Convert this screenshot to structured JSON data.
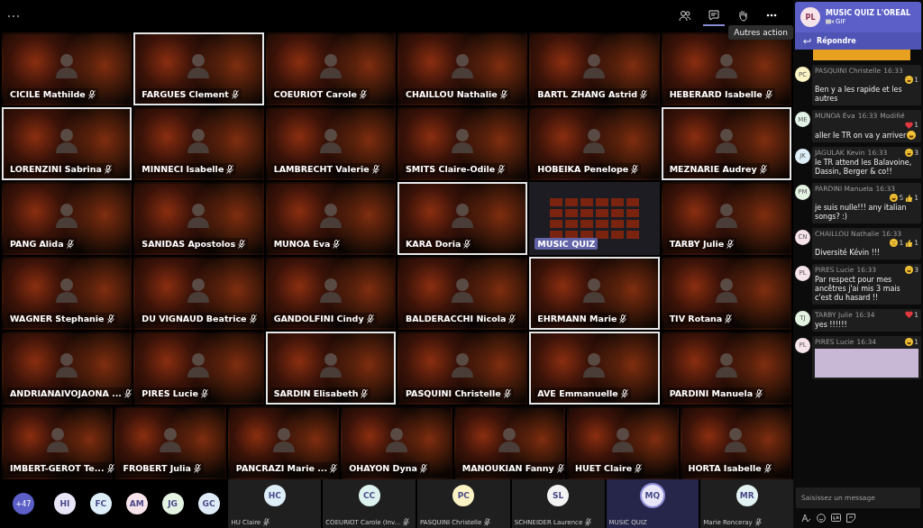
{
  "top_bar": {
    "actions": [
      {
        "kind": "participants",
        "selected": false
      },
      {
        "kind": "chat",
        "selected": true
      },
      {
        "kind": "hand",
        "selected": false
      },
      {
        "kind": "more",
        "selected": false
      }
    ],
    "tooltip": "Autres action"
  },
  "gallery": {
    "tiles": [
      {
        "name": "CICILE Mathilde",
        "framed": false,
        "kind": "camera",
        "muted": true
      },
      {
        "name": "FARGUES Clement",
        "framed": true,
        "kind": "camera",
        "muted": true
      },
      {
        "name": "COEURIOT Carole",
        "framed": false,
        "kind": "camera",
        "muted": true
      },
      {
        "name": "CHAILLOU Nathalie",
        "framed": false,
        "kind": "camera",
        "muted": true
      },
      {
        "name": "BARTL ZHANG Astrid",
        "framed": false,
        "kind": "camera",
        "muted": true
      },
      {
        "name": "HEBERARD Isabelle",
        "framed": false,
        "kind": "camera",
        "muted": true
      },
      {
        "name": "LORENZINI Sabrina",
        "framed": true,
        "kind": "camera",
        "muted": true
      },
      {
        "name": "MINNECI Isabelle",
        "framed": false,
        "kind": "camera",
        "muted": true
      },
      {
        "name": "LAMBRECHT Valerie",
        "framed": false,
        "kind": "camera",
        "muted": true
      },
      {
        "name": "SMITS Claire-Odile",
        "framed": false,
        "kind": "camera",
        "muted": true
      },
      {
        "name": "HOBEIKA Penelope",
        "framed": false,
        "kind": "camera",
        "muted": true
      },
      {
        "name": "MEZNARIE Audrey",
        "framed": true,
        "kind": "camera",
        "muted": true
      },
      {
        "name": "PANG Alida",
        "framed": false,
        "kind": "camera",
        "muted": true
      },
      {
        "name": "SANIDAS Apostolos",
        "framed": false,
        "kind": "camera",
        "muted": true
      },
      {
        "name": "MUNOA Eva",
        "framed": false,
        "kind": "camera",
        "muted": true
      },
      {
        "name": "KARA Doria",
        "framed": true,
        "kind": "camera",
        "muted": true
      },
      {
        "name": "MUSIC QUIZ",
        "framed": false,
        "kind": "screen_share",
        "muted": false
      },
      {
        "name": "TARBY Julie",
        "framed": false,
        "kind": "camera",
        "muted": true
      },
      {
        "name": "WAGNER Stephanie",
        "framed": false,
        "kind": "camera",
        "muted": true
      },
      {
        "name": "DU VIGNAUD Beatrice",
        "framed": false,
        "kind": "camera",
        "muted": true
      },
      {
        "name": "GANDOLFINI Cindy",
        "framed": false,
        "kind": "camera",
        "muted": true
      },
      {
        "name": "BALDERACCHI Nicola",
        "framed": false,
        "kind": "camera",
        "muted": true
      },
      {
        "name": "EHRMANN Marie",
        "framed": true,
        "kind": "camera",
        "muted": true
      },
      {
        "name": "TIV Rotana",
        "framed": false,
        "kind": "camera",
        "muted": true
      },
      {
        "name": "ANDRIANAIVOJAONA ...",
        "framed": false,
        "kind": "camera",
        "muted": true
      },
      {
        "name": "PIRES Lucie",
        "framed": false,
        "kind": "camera",
        "muted": true
      },
      {
        "name": "SARDIN Elisabeth",
        "framed": true,
        "kind": "camera",
        "muted": true
      },
      {
        "name": "PASQUINI Christelle",
        "framed": false,
        "kind": "camera",
        "muted": true
      },
      {
        "name": "AVE Emmanuelle",
        "framed": true,
        "kind": "camera",
        "muted": true
      },
      {
        "name": "PARDINI Manuela",
        "framed": false,
        "kind": "camera",
        "muted": true
      },
      {
        "name": "IMBERT-GEROT Te...",
        "framed": false,
        "kind": "camera",
        "muted": true
      },
      {
        "name": "FROBERT Julia",
        "framed": false,
        "kind": "camera",
        "muted": true
      },
      {
        "name": "PANCRAZI Marie ...",
        "framed": false,
        "kind": "camera",
        "muted": true
      },
      {
        "name": "OHAYON Dyna",
        "framed": false,
        "kind": "camera",
        "muted": true
      },
      {
        "name": "MANOUKIAN Fanny",
        "framed": false,
        "kind": "camera",
        "muted": true
      },
      {
        "name": "HUET Claire",
        "framed": false,
        "kind": "camera",
        "muted": true
      },
      {
        "name": "HORTA Isabelle",
        "framed": false,
        "kind": "camera",
        "muted": true
      }
    ]
  },
  "bottom_bar": {
    "overflow": "+47",
    "avatars": [
      {
        "initials": "HI",
        "color": "#e8e6f7"
      },
      {
        "initials": "FC",
        "color": "#ddeef8"
      },
      {
        "initials": "AM",
        "color": "#f7e3ea"
      },
      {
        "initials": "JG",
        "color": "#e3f2e1"
      },
      {
        "initials": "GC",
        "color": "#dfeaf7"
      }
    ],
    "participants": [
      {
        "initials": "HC",
        "name": "HU Claire",
        "color": "#ddeef8",
        "muted": true,
        "selected": false
      },
      {
        "initials": "CC",
        "name": "COEURIOT Carole (Inv...",
        "color": "#dcf2ef",
        "muted": true,
        "selected": false
      },
      {
        "initials": "PC",
        "name": "PASQUINI Christelle",
        "color": "#fbf3c4",
        "muted": true,
        "selected": false
      },
      {
        "initials": "SL",
        "name": "SCHNEIDER Laurence",
        "color": "#f3f3f3",
        "muted": true,
        "selected": false
      },
      {
        "initials": "MQ",
        "name": "MUSIC QUIZ",
        "color": "#e8e6f7",
        "muted": false,
        "selected": true
      },
      {
        "initials": "MR",
        "name": "Marie Ronceray",
        "color": "#e3f2f2",
        "muted": true,
        "selected": false
      }
    ]
  },
  "chat": {
    "notification": {
      "initials": "PL",
      "title": "MUSIC QUIZ L'OREAL",
      "subtitle": "GIF",
      "reply": "Répondre"
    },
    "messages": [
      {
        "initials": "PC",
        "color": "#fbf3c4",
        "author": "PASQUINI Christelle",
        "time": "16:33",
        "text": "Ben y a les rapide et les autres",
        "reactions": [
          {
            "kind": "laugh",
            "count": "1"
          }
        ]
      },
      {
        "initials": "ME",
        "color": "#e3f2e6",
        "author": "MUNOA Eva",
        "time": "16:33",
        "edited": "Modifié",
        "text": "aller le TR on va y arriver",
        "emoji_end": true,
        "reactions": [
          {
            "kind": "heart",
            "count": "1"
          }
        ]
      },
      {
        "initials": "JK",
        "color": "#ddeef8",
        "author": "JAGULAK Kevin",
        "time": "16:33",
        "text": "le TR attend les Balavoine, Dassin, Berger & co!!",
        "reactions": [
          {
            "kind": "laugh",
            "count": "3"
          }
        ]
      },
      {
        "initials": "PM",
        "color": "#e3f2e1",
        "author": "PARDINI Manuela",
        "time": "16:33",
        "text": "je suis nulle!!! any italian songs? :)",
        "reactions": [
          {
            "kind": "laugh",
            "count": "5"
          },
          {
            "kind": "thumb",
            "count": "1"
          }
        ]
      },
      {
        "initials": "CN",
        "color": "#f7e3ea",
        "author": "CHAILLOU Nathalie",
        "time": "16:33",
        "text": "Diversité Kévin !!!",
        "reactions": [
          {
            "kind": "sad",
            "count": "1"
          },
          {
            "kind": "thumb",
            "count": "1"
          }
        ]
      },
      {
        "initials": "PL",
        "color": "#f7e3ea",
        "author": "PIRES Lucie",
        "time": "16:33",
        "text": "Par respect pour mes ancêtres j'ai mis 3 mais c'est du hasard !!",
        "reactions": [
          {
            "kind": "laugh",
            "count": "3"
          }
        ]
      },
      {
        "initials": "TJ",
        "color": "#e3f2e1",
        "author": "TARBY Julie",
        "time": "16:34",
        "text": "yes !!!!!!",
        "reactions": [
          {
            "kind": "heart",
            "count": "1"
          }
        ]
      },
      {
        "initials": "PL",
        "color": "#f7e3ea",
        "author": "PIRES Lucie",
        "time": "16:34",
        "image": true,
        "reactions": [
          {
            "kind": "laugh",
            "count": "1"
          }
        ]
      }
    ],
    "composer": {
      "placeholder": "Saisissez un message",
      "tools": [
        {
          "kind": "format"
        },
        {
          "kind": "emoji"
        },
        {
          "kind": "gif"
        },
        {
          "kind": "sticker"
        }
      ]
    }
  }
}
